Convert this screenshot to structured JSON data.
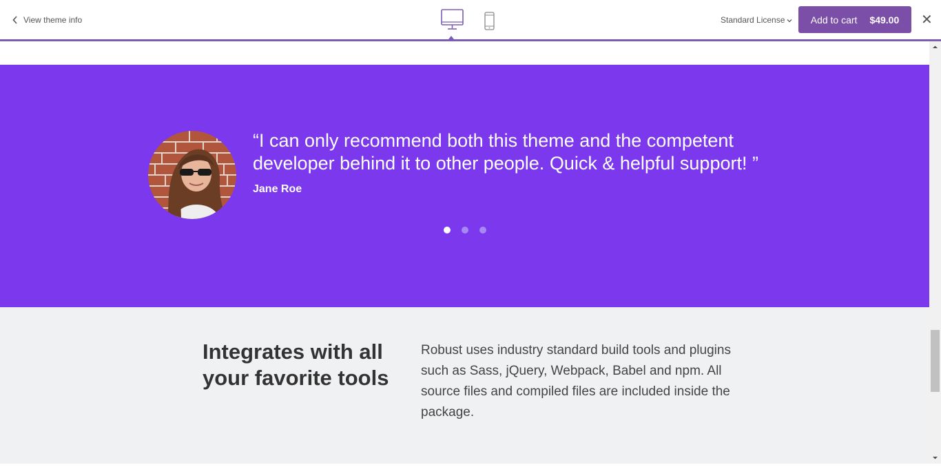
{
  "topbar": {
    "back_label": "View theme info",
    "license_label": "Standard License",
    "cart_label": "Add to cart",
    "cart_price": "$49.00",
    "close_glyph": "✕",
    "accent_color": "#7b5cb5"
  },
  "testimonial": {
    "quote": "“I can only recommend both this theme and the competent developer behind it to other people. Quick & helpful support! ”",
    "author": "Jane Roe",
    "active_slide": 1,
    "slide_count": 3,
    "background": "#7c38ec"
  },
  "features": {
    "title": "Integrates with all your favorite tools",
    "text": "Robust uses industry standard build tools and plugins such as Sass, jQuery, Webpack, Babel and npm. All source files and compiled files are included inside the package."
  }
}
